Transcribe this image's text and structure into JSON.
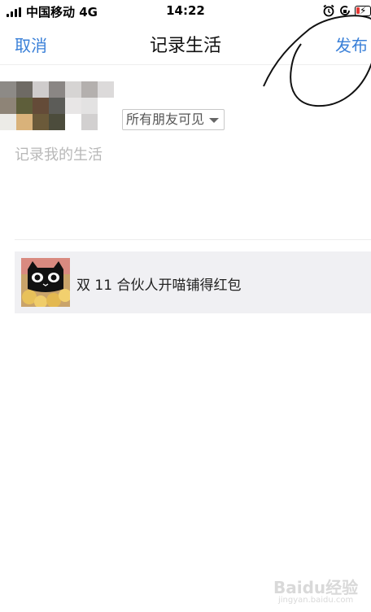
{
  "status_bar": {
    "carrier": "中国移动 4G",
    "time": "14:22"
  },
  "nav": {
    "cancel_label": "取消",
    "title": "记录生活",
    "publish_label": "发布"
  },
  "compose": {
    "visibility": "所有朋友可见",
    "placeholder": "记录我的生活"
  },
  "share_card": {
    "title": "双 11 合伙人开喵铺得红包"
  },
  "watermark": {
    "name": "Baidu经验",
    "url": "jingyan.baidu.com"
  },
  "colors": {
    "accent": "#3a80d8",
    "card_bg": "#f0f0f3",
    "annotation": "#111111"
  }
}
